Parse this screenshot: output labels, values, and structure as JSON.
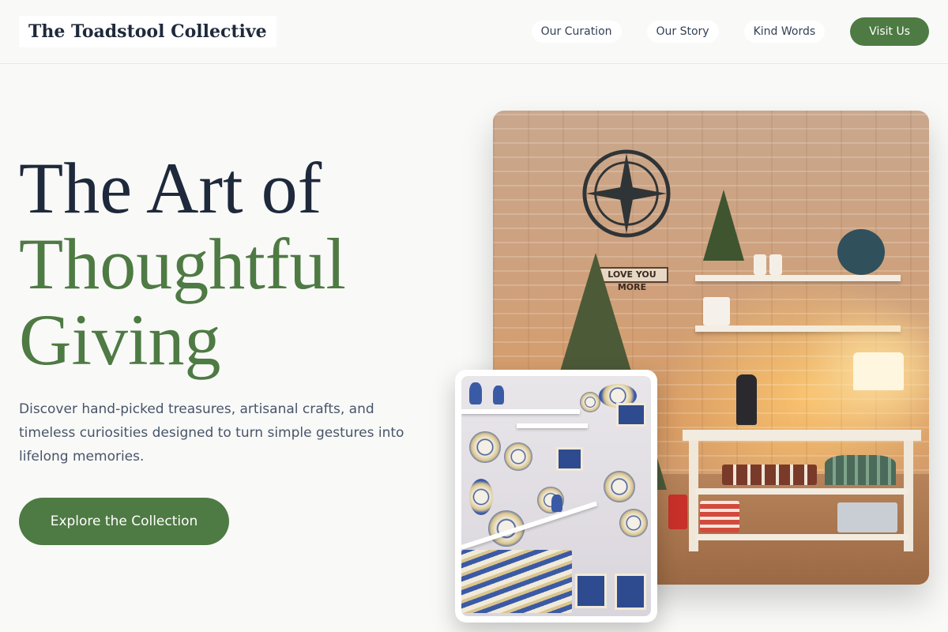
{
  "header": {
    "logo": "The Toadstool Collective",
    "nav": [
      {
        "label": "Our Curation"
      },
      {
        "label": "Our Story"
      },
      {
        "label": "Kind Words"
      }
    ],
    "visit_label": "Visit Us"
  },
  "hero": {
    "title_line1": "The Art of",
    "title_line2": "Thoughtful",
    "title_line3": "Giving",
    "description": "Discover hand-picked treasures, artisanal crafts, and timeless curiosities designed to turn simple gestures into lifelong memories.",
    "cta_label": "Explore the Collection"
  },
  "images": {
    "main_sign_text": "LOVE YOU MORE"
  },
  "colors": {
    "accent_green": "#4e7a43",
    "heading_dark": "#1e293b",
    "background": "#f9f9f8"
  }
}
